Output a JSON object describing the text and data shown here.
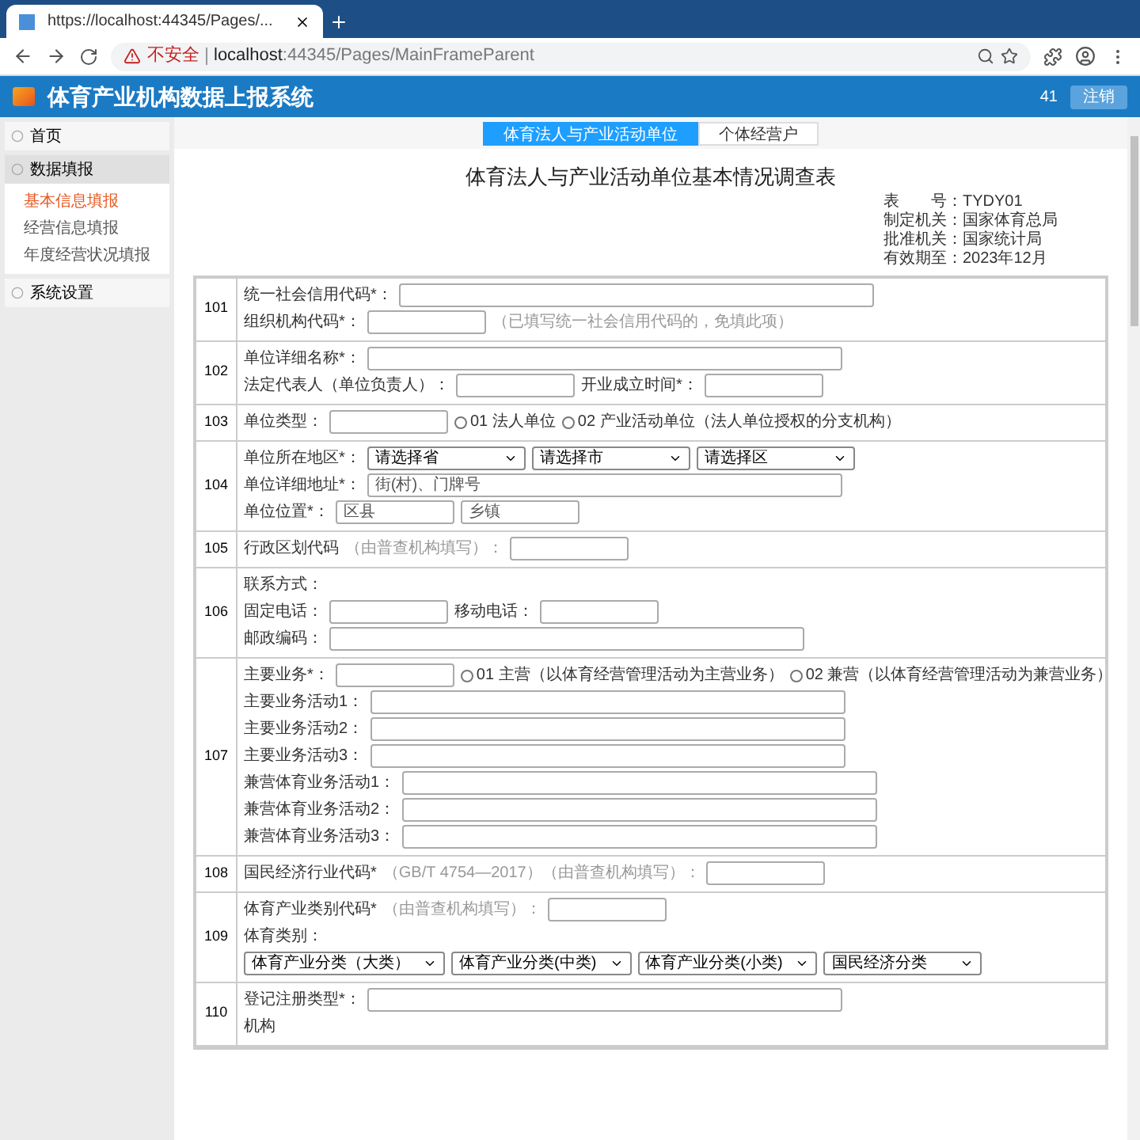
{
  "browser": {
    "tab_title": "https://localhost:44345/Pages/...",
    "security": "不安全",
    "url_host": "localhost",
    "url_path": ":44345/Pages/MainFrameParent"
  },
  "app": {
    "title": "体育产业机构数据上报系统",
    "user": "41",
    "logout": "注销"
  },
  "sidebar": [
    {
      "label": "首页",
      "expanded": false
    },
    {
      "label": "数据填报",
      "expanded": true,
      "children": [
        {
          "label": "基本信息填报",
          "selected": true
        },
        {
          "label": "经营信息填报",
          "selected": false
        },
        {
          "label": "年度经营状况填报",
          "selected": false
        }
      ]
    },
    {
      "label": "系统设置",
      "expanded": false
    }
  ],
  "tabs": [
    {
      "label": "体育法人与产业活动单位",
      "selected": true
    },
    {
      "label": "个体经营户",
      "selected": false
    }
  ],
  "form": {
    "title": "体育法人与产业活动单位基本情况调查表",
    "meta": [
      "表　　号：TYDY01",
      "制定机关：国家体育总局",
      "批准机关：国家统计局",
      "有效期至：2023年12月"
    ],
    "rows": [
      {
        "code": "101",
        "lines": [
          [
            {
              "kind": "label",
              "text": "统一社会信用代码*："
            },
            {
              "kind": "input"
            }
          ],
          [
            {
              "kind": "label",
              "text": "组织机构代码*："
            },
            {
              "kind": "input"
            },
            {
              "kind": "note",
              "text": "（已填写统一社会信用代码的，免填此项）"
            }
          ]
        ]
      },
      {
        "code": "102",
        "lines": [
          [
            {
              "kind": "label",
              "text": "单位详细名称*："
            },
            {
              "kind": "input"
            }
          ],
          [
            {
              "kind": "label",
              "text": "法定代表人（单位负责人）："
            },
            {
              "kind": "input"
            },
            {
              "kind": "label",
              "text": "开业成立时间*："
            },
            {
              "kind": "input"
            }
          ]
        ]
      },
      {
        "code": "103",
        "lines": [
          [
            {
              "kind": "label",
              "text": "单位类型："
            },
            {
              "kind": "input"
            },
            {
              "kind": "radio",
              "text": "01 法人单位",
              "selected": false
            },
            {
              "kind": "radio",
              "text": "02 产业活动单位（法人单位授权的分支机构）",
              "selected": false
            }
          ]
        ]
      },
      {
        "code": "104",
        "lines": [
          [
            {
              "kind": "label",
              "text": "单位所在地区*："
            },
            {
              "kind": "select",
              "value": "请选择省"
            },
            {
              "kind": "select",
              "value": "请选择市"
            },
            {
              "kind": "select",
              "value": "请选择区"
            }
          ],
          [
            {
              "kind": "label",
              "text": "单位详细地址*："
            },
            {
              "kind": "input",
              "placeholder": "街(村)、门牌号"
            }
          ],
          [
            {
              "kind": "label",
              "text": "单位位置*："
            },
            {
              "kind": "input",
              "placeholder": "区县"
            },
            {
              "kind": "input",
              "placeholder": "乡镇"
            }
          ]
        ]
      },
      {
        "code": "105",
        "lines": [
          [
            {
              "kind": "label",
              "text": "行政区划代码"
            },
            {
              "kind": "note",
              "text": "（由普查机构填写）："
            },
            {
              "kind": "input"
            }
          ]
        ]
      },
      {
        "code": "106",
        "lines": [
          [
            {
              "kind": "label",
              "text": "联系方式："
            }
          ],
          [
            {
              "kind": "label",
              "text": "固定电话："
            },
            {
              "kind": "input"
            },
            {
              "kind": "label",
              "text": "移动电话："
            },
            {
              "kind": "input"
            }
          ],
          [
            {
              "kind": "label",
              "text": "邮政编码："
            },
            {
              "kind": "input"
            }
          ]
        ]
      },
      {
        "code": "107",
        "lines": [
          [
            {
              "kind": "label",
              "text": "主要业务*："
            },
            {
              "kind": "input"
            },
            {
              "kind": "radio",
              "text": "01 主营（以体育经营管理活动为主营业务）",
              "selected": false
            },
            {
              "kind": "radio",
              "text": "02 兼营（以体育经营管理活动为兼营业务）",
              "selected": false
            }
          ],
          [
            {
              "kind": "label",
              "text": "主要业务活动1："
            },
            {
              "kind": "input"
            }
          ],
          [
            {
              "kind": "label",
              "text": "主要业务活动2："
            },
            {
              "kind": "input"
            }
          ],
          [
            {
              "kind": "label",
              "text": "主要业务活动3："
            },
            {
              "kind": "input"
            }
          ],
          [
            {
              "kind": "label",
              "text": "兼营体育业务活动1："
            },
            {
              "kind": "input"
            }
          ],
          [
            {
              "kind": "label",
              "text": "兼营体育业务活动2："
            },
            {
              "kind": "input"
            }
          ],
          [
            {
              "kind": "label",
              "text": "兼营体育业务活动3："
            },
            {
              "kind": "input"
            }
          ]
        ]
      },
      {
        "code": "108",
        "lines": [
          [
            {
              "kind": "label",
              "text": "国民经济行业代码*"
            },
            {
              "kind": "note",
              "text": "（GB/T 4754—2017）（由普查机构填写）："
            },
            {
              "kind": "input"
            }
          ]
        ]
      },
      {
        "code": "109",
        "lines": [
          [
            {
              "kind": "label",
              "text": "体育产业类别代码*"
            },
            {
              "kind": "note",
              "text": "（由普查机构填写）："
            },
            {
              "kind": "input"
            }
          ],
          [
            {
              "kind": "label",
              "text": "体育类别："
            }
          ],
          [
            {
              "kind": "select",
              "value": "体育产业分类（大类）"
            },
            {
              "kind": "select",
              "value": "体育产业分类(中类)"
            },
            {
              "kind": "select",
              "value": "体育产业分类(小类)"
            },
            {
              "kind": "select",
              "value": "国民经济分类"
            }
          ]
        ]
      },
      {
        "code": "110",
        "lines": [
          [
            {
              "kind": "label",
              "text": "登记注册类型*："
            },
            {
              "kind": "input"
            }
          ],
          [
            {
              "kind": "label",
              "text": "机构"
            }
          ]
        ]
      }
    ]
  }
}
